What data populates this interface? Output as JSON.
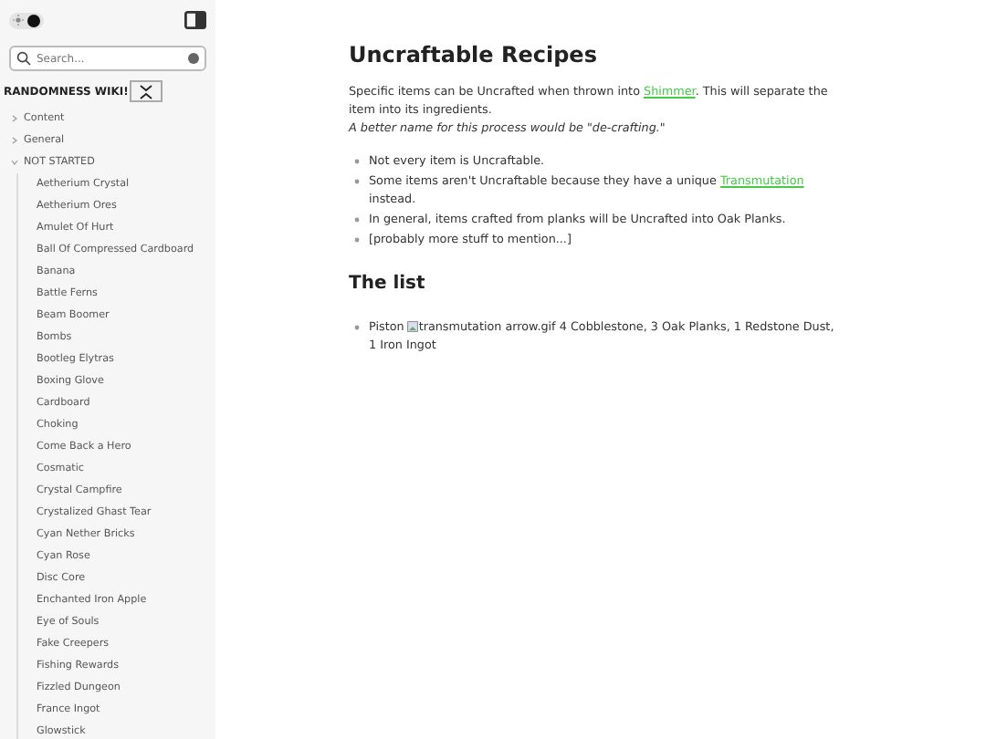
{
  "sidebar": {
    "theme": {
      "dark": true
    },
    "search": {
      "placeholder": "Search..."
    },
    "wiki_title": "RANDOMNESS WIKI!",
    "tree": [
      {
        "label": "Content",
        "expanded": false
      },
      {
        "label": "General",
        "expanded": false
      },
      {
        "label": "NOT STARTED",
        "expanded": true,
        "children": [
          "Aetherium Crystal",
          "Aetherium Ores",
          "Amulet Of Hurt",
          "Ball Of Compressed Cardboard",
          "Banana",
          "Battle Ferns",
          "Beam Boomer",
          "Bombs",
          "Bootleg Elytras",
          "Boxing Glove",
          "Cardboard",
          "Choking",
          "Come Back a Hero",
          "Cosmatic",
          "Crystal Campfire",
          "Crystalized Ghast Tear",
          "Cyan Nether Bricks",
          "Cyan Rose",
          "Disc Core",
          "Enchanted Iron Apple",
          "Eye of Souls",
          "Fake Creepers",
          "Fishing Rewards",
          "Fizzled Dungeon",
          "France Ingot",
          "Glowstick"
        ]
      }
    ]
  },
  "article": {
    "title": "Uncraftable Recipes",
    "intro": [
      {
        "kind": "text",
        "text": "Specific items can be Uncrafted when thrown into "
      },
      {
        "kind": "link",
        "text": "Shimmer"
      },
      {
        "kind": "text",
        "text": ". This will separate the item into its ingredients."
      }
    ],
    "note": "A better name for this process would be \"de-crafting.\"",
    "bullets": [
      [
        {
          "kind": "text",
          "text": "Not every item is Uncraftable."
        }
      ],
      [
        {
          "kind": "text",
          "text": "Some items aren't Uncraftable because they have a unique "
        },
        {
          "kind": "link",
          "text": "Transmutation"
        },
        {
          "kind": "text",
          "text": " instead."
        }
      ],
      [
        {
          "kind": "text",
          "text": "In general, items crafted from planks will be Uncrafted into Oak Planks."
        }
      ],
      [
        {
          "kind": "text",
          "text": "[probably more stuff to mention...]"
        }
      ]
    ],
    "list_heading": "The list",
    "list": [
      [
        {
          "kind": "text",
          "text": "Piston "
        },
        {
          "kind": "image",
          "text": "transmutation arrow.gif"
        },
        {
          "kind": "text",
          "text": " 4 Cobblestone, 3 Oak Planks, 1 Redstone Dust, 1 Iron Ingot"
        }
      ]
    ]
  }
}
